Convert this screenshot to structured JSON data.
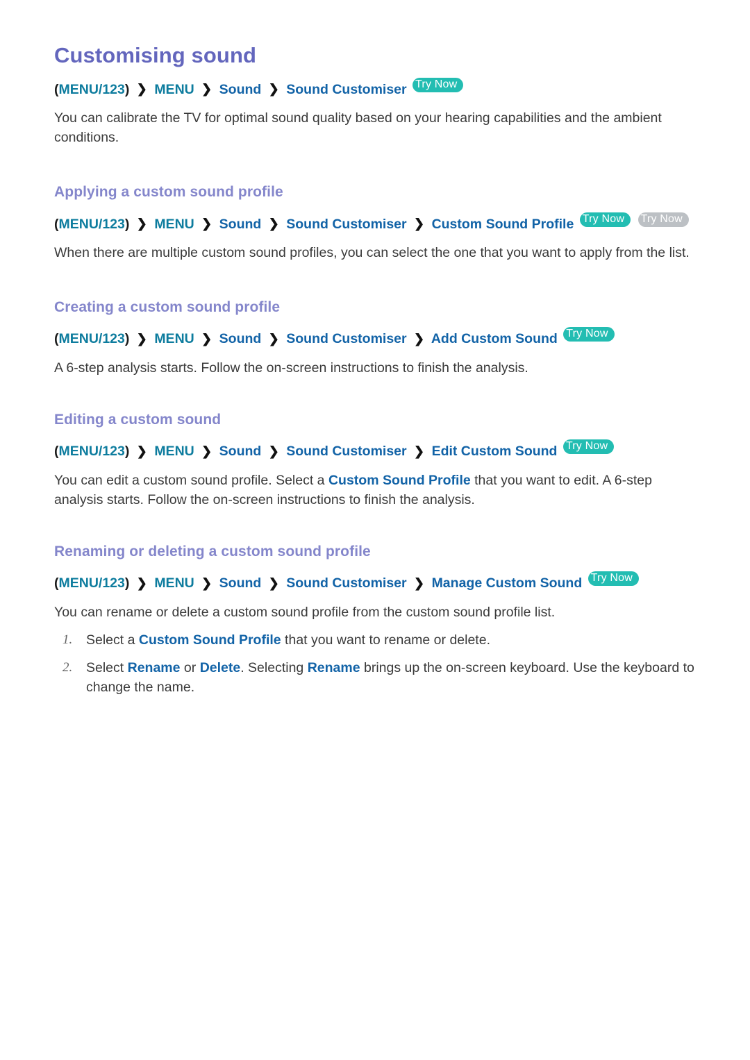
{
  "page": {
    "title": "Customising sound"
  },
  "colors": {
    "title": "#6366bd",
    "heading": "#8486cb",
    "teal_link": "#0d7c9e",
    "blue_link": "#1263a7",
    "badge_teal": "#23bdb2",
    "badge_grey": "#bcc0c4",
    "body": "#3a3a3a"
  },
  "labels": {
    "try_now": "Try Now",
    "separator": "❯",
    "paren_open": "(",
    "paren_close": ")"
  },
  "intro": {
    "path": {
      "root": "MENU/123",
      "items": [
        "MENU",
        "Sound",
        "Sound Customiser"
      ]
    },
    "badges": [
      "teal"
    ],
    "body": "You can calibrate the TV for optimal sound quality based on your hearing capabilities and the ambient conditions."
  },
  "sections": [
    {
      "heading": "Applying a custom sound profile",
      "path": {
        "root": "MENU/123",
        "items": [
          "MENU",
          "Sound",
          "Sound Customiser",
          "Custom Sound Profile"
        ]
      },
      "badges": [
        "teal",
        "grey"
      ],
      "body": "When there are multiple custom sound profiles, you can select the one that you want to apply from the list."
    },
    {
      "heading": "Creating a custom sound profile",
      "path": {
        "root": "MENU/123",
        "items": [
          "MENU",
          "Sound",
          "Sound Customiser",
          "Add Custom Sound"
        ]
      },
      "badges": [
        "teal"
      ],
      "body": "A 6-step analysis starts. Follow the on-screen instructions to finish the analysis."
    },
    {
      "heading": "Editing a custom sound",
      "path": {
        "root": "MENU/123",
        "items": [
          "MENU",
          "Sound",
          "Sound Customiser",
          "Edit Custom Sound"
        ]
      },
      "badges": [
        "teal"
      ],
      "body_parts": {
        "p1": "You can edit a custom sound profile. Select a ",
        "link": "Custom Sound Profile",
        "p2": " that you want to edit. A 6-step analysis starts. Follow the on-screen instructions to finish the analysis."
      }
    },
    {
      "heading": "Renaming or deleting a custom sound profile",
      "path": {
        "root": "MENU/123",
        "items": [
          "MENU",
          "Sound",
          "Sound Customiser",
          "Manage Custom Sound"
        ]
      },
      "badges": [
        "teal"
      ],
      "body": "You can rename or delete a custom sound profile from the custom sound profile list.",
      "steps": [
        {
          "num": "1.",
          "p1": "Select a ",
          "link1": "Custom Sound Profile",
          "p2": " that you want to rename or delete."
        },
        {
          "num": "2.",
          "p1": "Select ",
          "link1": "Rename",
          "p2": " or ",
          "link2": "Delete",
          "p3": ". Selecting ",
          "link3": "Rename",
          "p4": " brings up the on-screen keyboard. Use the keyboard to change the name."
        }
      ]
    }
  ]
}
